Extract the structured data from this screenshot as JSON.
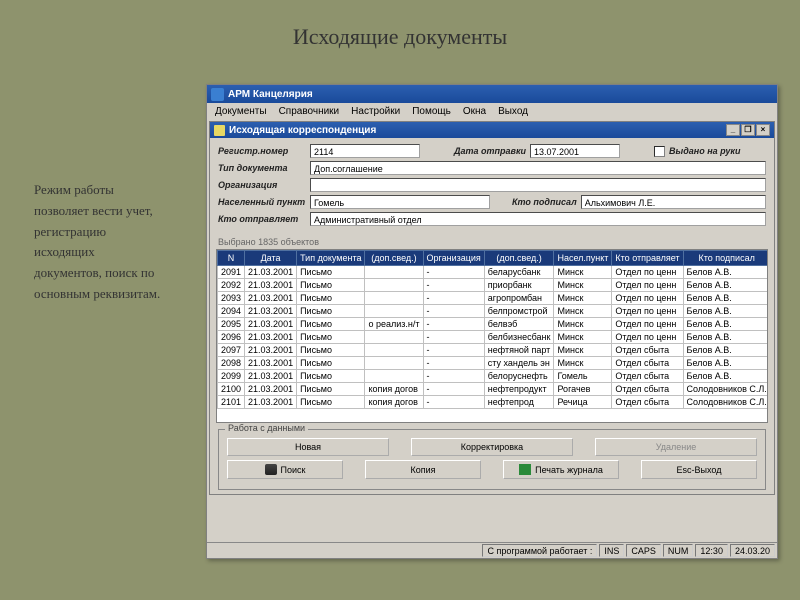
{
  "slide": {
    "title": "Исходящие документы",
    "text": "Режим работы позволяет вести учет, регистрацию исходящих документов, поиск по основным реквизитам."
  },
  "app_title": "АРМ Канцелярия",
  "menu": {
    "items": [
      "Документы",
      "Справочники",
      "Настройки",
      "Помощь",
      "Окна",
      "Выход"
    ]
  },
  "child_title": "Исходящая корреспонденция",
  "form": {
    "reg_label": "Регистр.номер",
    "reg_value": "2114",
    "date_label": "Дата отправки",
    "date_value": "13.07.2001",
    "checkbox_label": "Выдано на руки",
    "doctype_label": "Тип документа",
    "doctype_value": "Доп.соглашение",
    "org_label": "Организация",
    "org_value": "",
    "locality_label": "Населенный пункт",
    "locality_value": "Гомель",
    "signed_label": "Кто подписал",
    "signed_value": "Альхимович Л.Е.",
    "sender_label": "Кто отправляет",
    "sender_value": "Административный отдел"
  },
  "selection_note": "Выбрано 1835 объектов",
  "grid": {
    "columns": [
      "N",
      "Дата",
      "Тип документа",
      "(доп.свед.)",
      "Организация",
      "(доп.свед.)",
      "Насел.пункт",
      "Кто отправляет",
      "Кто подписал"
    ],
    "rows": [
      [
        "2091",
        "21.03.2001",
        "Письмо",
        "",
        "-",
        "беларусбанк",
        "Минск",
        "Отдел по ценн",
        "Белов А.В."
      ],
      [
        "2092",
        "21.03.2001",
        "Письмо",
        "",
        "-",
        "приорбанк",
        "Минск",
        "Отдел по ценн",
        "Белов А.В."
      ],
      [
        "2093",
        "21.03.2001",
        "Письмо",
        "",
        "-",
        "агропромбан",
        "Минск",
        "Отдел по ценн",
        "Белов А.В."
      ],
      [
        "2094",
        "21.03.2001",
        "Письмо",
        "",
        "-",
        "белпромстрой",
        "Минск",
        "Отдел по ценн",
        "Белов А.В."
      ],
      [
        "2095",
        "21.03.2001",
        "Письмо",
        "о реализ.н/т",
        "-",
        "белвэб",
        "Минск",
        "Отдел по ценн",
        "Белов А.В."
      ],
      [
        "2096",
        "21.03.2001",
        "Письмо",
        "",
        "-",
        "белбизнесбанк",
        "Минск",
        "Отдел по ценн",
        "Белов А.В."
      ],
      [
        "2097",
        "21.03.2001",
        "Письмо",
        "",
        "-",
        "нефтяной парт",
        "Минск",
        "Отдел сбыта",
        "Белов А.В."
      ],
      [
        "2098",
        "21.03.2001",
        "Письмо",
        "",
        "-",
        "сту хандель эн",
        "Минск",
        "Отдел сбыта",
        "Белов А.В."
      ],
      [
        "2099",
        "21.03.2001",
        "Письмо",
        "",
        "-",
        "белоруснефть",
        "Гомель",
        "Отдел сбыта",
        "Белов А.В."
      ],
      [
        "2100",
        "21.03.2001",
        "Письмо",
        "копия догов",
        "-",
        "нефтепродукт",
        "Рогачев",
        "Отдел сбыта",
        "Солодовников С.Л."
      ],
      [
        "2101",
        "21.03.2001",
        "Письмо",
        "копия догов",
        "-",
        "нефтепрод",
        "Речица",
        "Отдел сбыта",
        "Солодовников С.Л."
      ]
    ]
  },
  "actions": {
    "group_label": "Работа с данными",
    "new": "Новая",
    "edit": "Корректировка",
    "delete": "Удаление",
    "search": "Поиск",
    "copy": "Копия",
    "print": "Печать журнала",
    "exit": "Esc-Выход"
  },
  "status": {
    "user_label": "С программой работает :",
    "ind": [
      "INS",
      "CAPS",
      "NUM"
    ],
    "time": "12:30",
    "date": "24.03.20"
  }
}
